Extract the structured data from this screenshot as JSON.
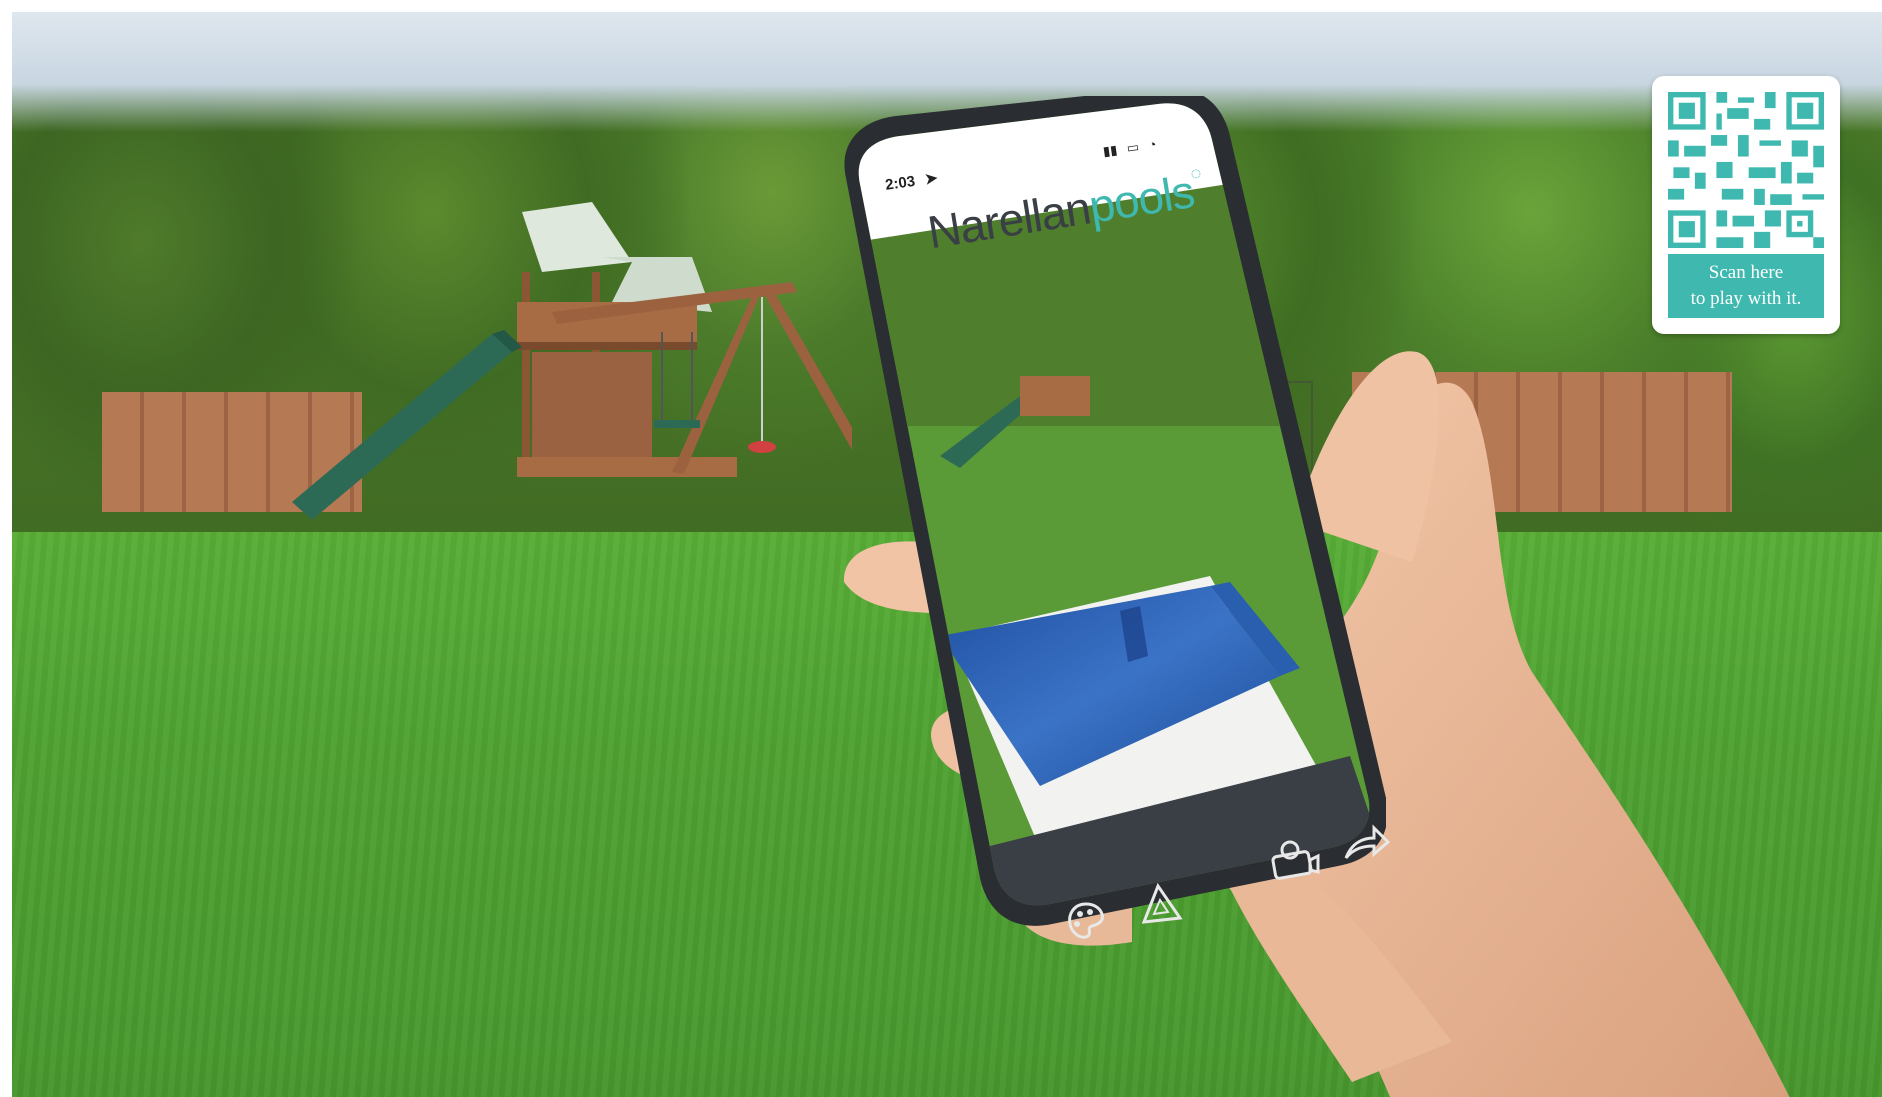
{
  "phone": {
    "status_time": "2:03",
    "brand_name": "Narellan",
    "brand_suffix": "pools",
    "toolbar_icons": [
      "palette-icon",
      "ruler-triangle-icon",
      "camera-icon",
      "share-icon"
    ]
  },
  "qr": {
    "label_line1": "Scan here",
    "label_line2": "to play with it."
  },
  "colors": {
    "brand_teal": "#3fb9b0",
    "brand_dark": "#3a3f45",
    "lawn_green": "#4ea132",
    "pool_blue": "#2a5fb0"
  }
}
